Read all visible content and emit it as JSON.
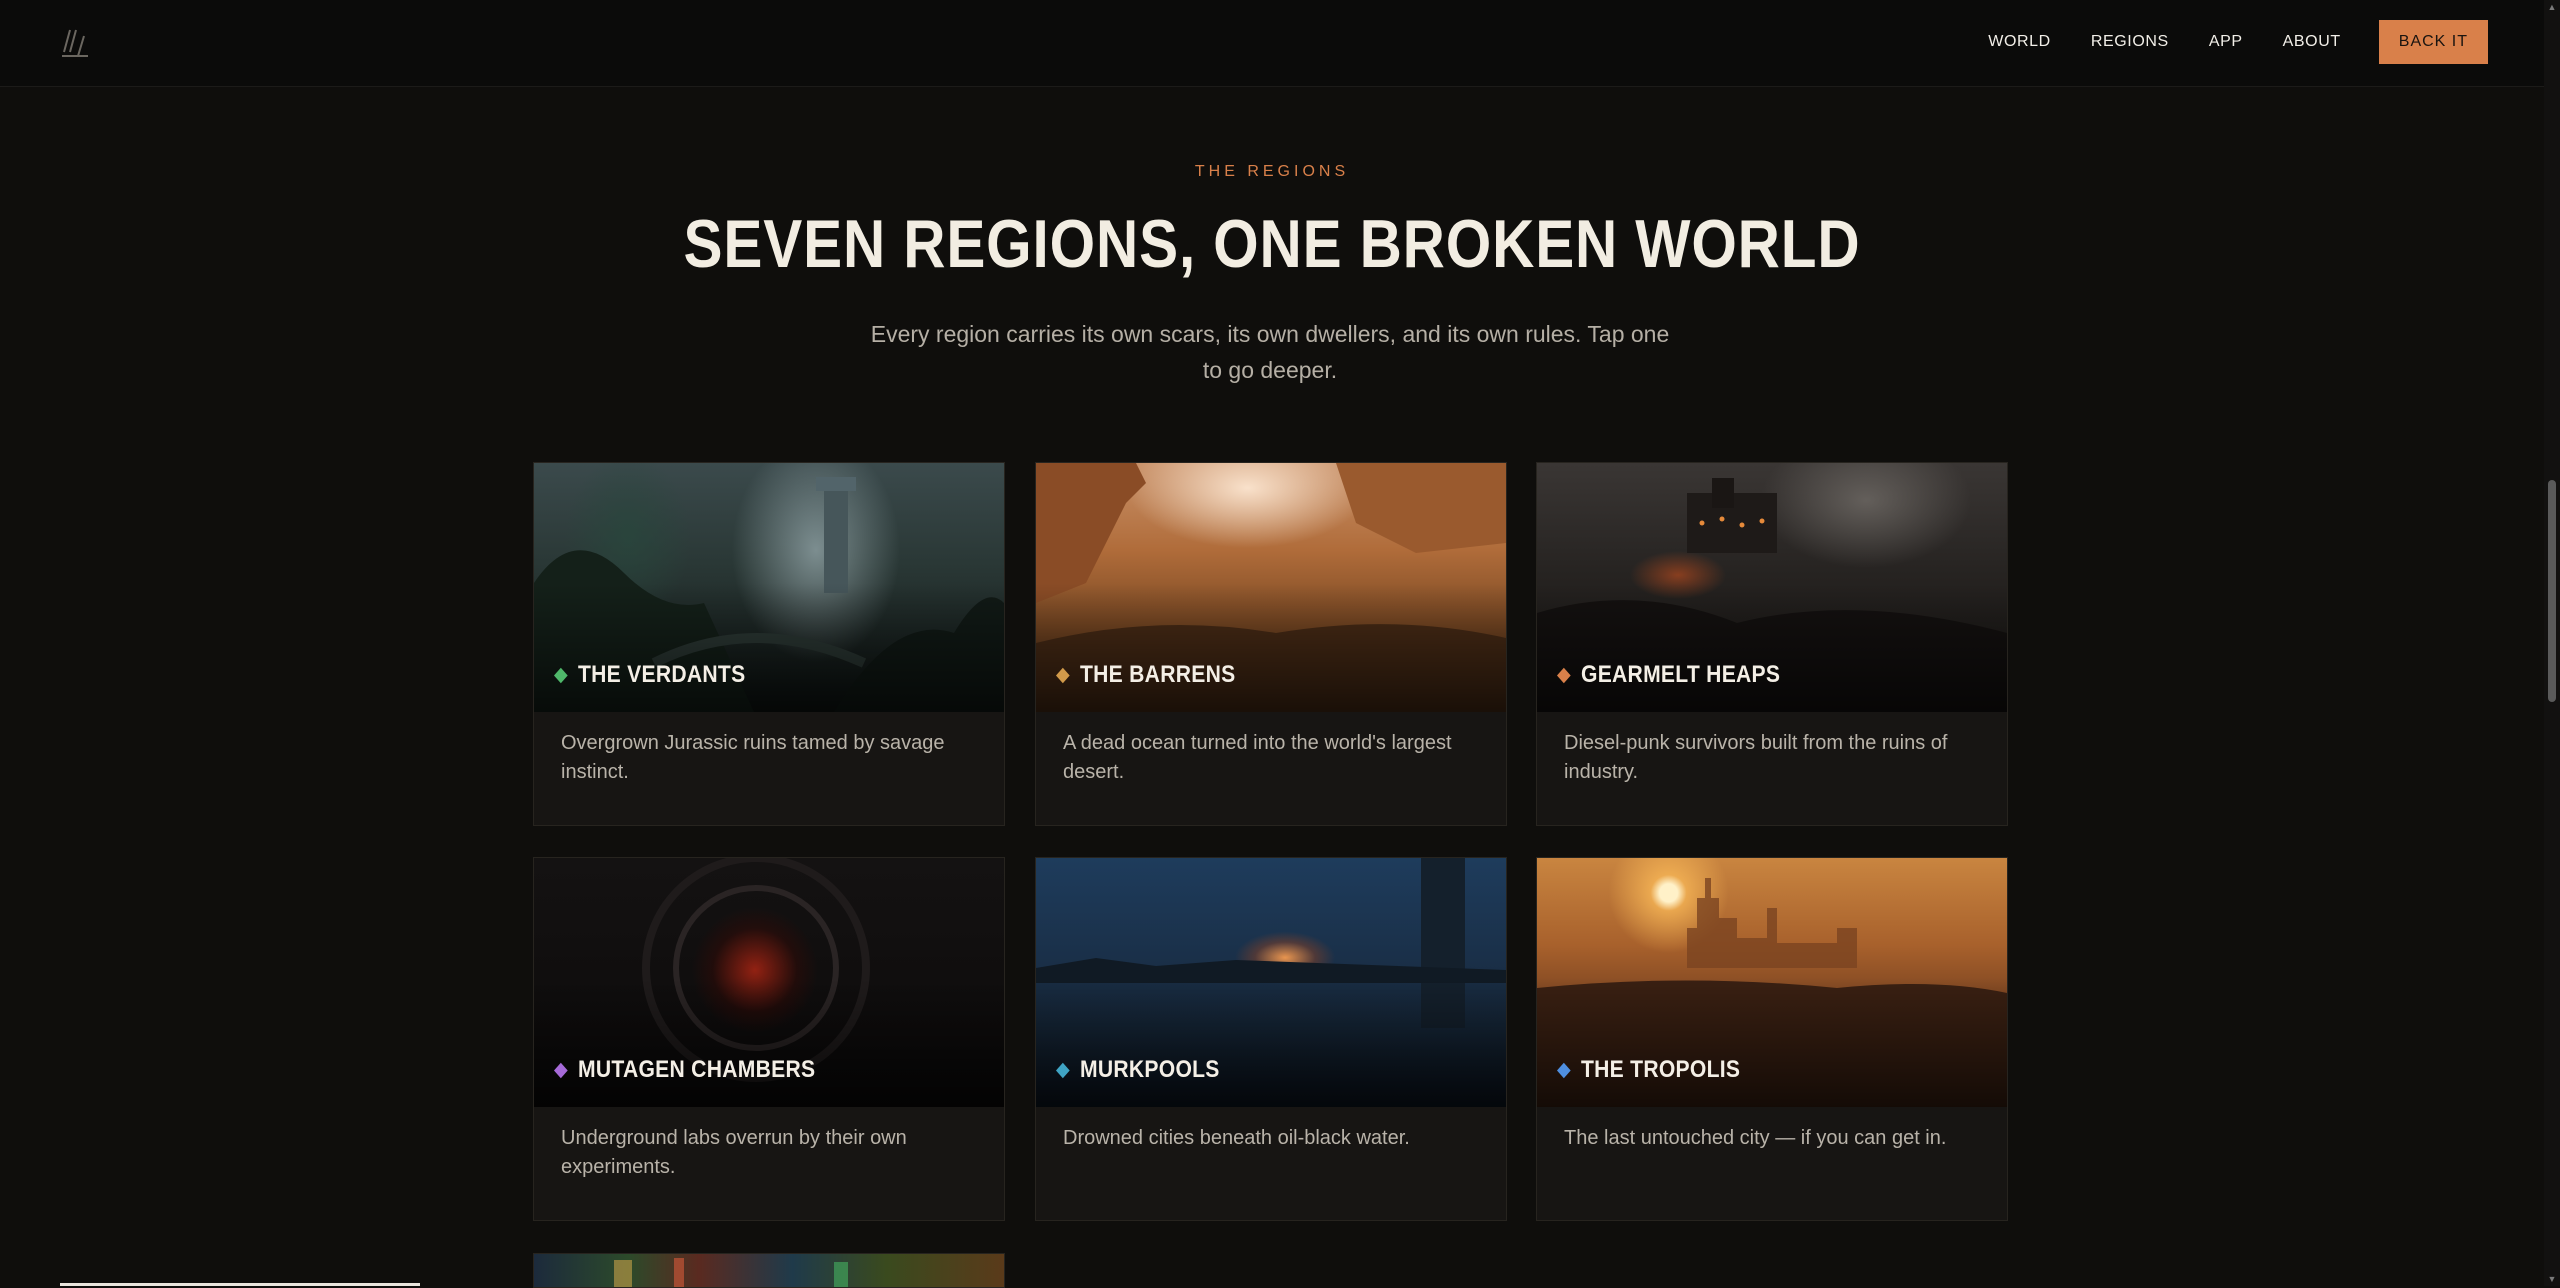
{
  "nav": {
    "items": [
      "WORLD",
      "REGIONS",
      "APP",
      "ABOUT"
    ],
    "cta": "BACK IT"
  },
  "section": {
    "eyebrow": "THE REGIONS",
    "title": "SEVEN REGIONS, ONE BROKEN WORLD",
    "subtitle": "Every region carries its own scars, its own dwellers, and its own rules. Tap one to go deeper."
  },
  "colors": {
    "accent": "#d9804a",
    "verdants": "#4fb86a",
    "barrens": "#d19a4a",
    "gearmelt": "#d9804a",
    "mutagen": "#a66ad8",
    "murkpools": "#3fa4c4",
    "tropolis": "#4f8fe0"
  },
  "regions": [
    {
      "name": "THE VERDANTS",
      "desc": "Overgrown Jurassic ruins tamed by savage instinct."
    },
    {
      "name": "THE BARRENS",
      "desc": "A dead ocean turned into the world's largest desert."
    },
    {
      "name": "GEARMELT HEAPS",
      "desc": "Diesel-punk survivors built from the ruins of industry."
    },
    {
      "name": "MUTAGEN CHAMBERS",
      "desc": "Underground labs overrun by their own experiments."
    },
    {
      "name": "MURKPOOLS",
      "desc": "Drowned cities beneath oil-black water."
    },
    {
      "name": "THE TROPOLIS",
      "desc": "The last untouched city — if you can get in."
    }
  ]
}
